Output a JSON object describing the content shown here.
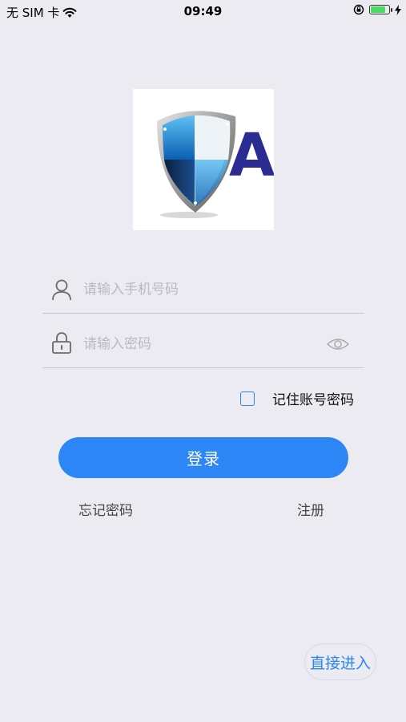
{
  "status_bar": {
    "carrier": "无 SIM 卡",
    "time": "09:49",
    "battery_color": "#4cd964"
  },
  "logo": {
    "letter": "A",
    "icon": "shield-logo-icon"
  },
  "form": {
    "phone": {
      "placeholder": "请输入手机号码",
      "icon": "user-icon"
    },
    "password": {
      "placeholder": "请输入密码",
      "icon": "lock-icon",
      "toggle_icon": "eye-icon"
    },
    "remember_label": "记住账号密码",
    "remember_checked": false
  },
  "actions": {
    "login_label": "登录",
    "forgot_label": "忘记密码",
    "register_label": "注册",
    "direct_label": "直接进入"
  },
  "colors": {
    "accent": "#2d86f5",
    "background": "#ebebf1"
  }
}
